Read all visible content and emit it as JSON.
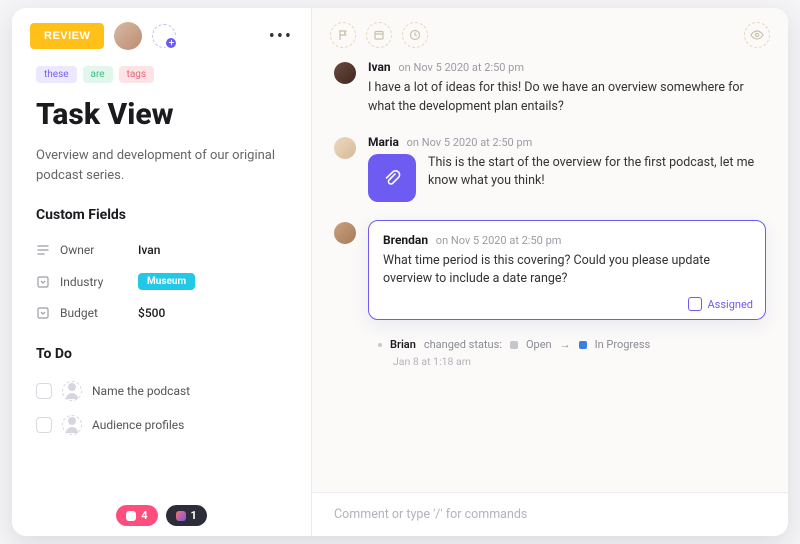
{
  "header": {
    "status_button": "REVIEW",
    "more_label": "•••"
  },
  "tags": [
    {
      "text": "these",
      "cls": "purple"
    },
    {
      "text": "are",
      "cls": "green"
    },
    {
      "text": "tags",
      "cls": "red"
    }
  ],
  "task": {
    "title": "Task View",
    "description": "Overview and development of our original podcast series."
  },
  "custom_fields": {
    "heading": "Custom Fields",
    "rows": [
      {
        "icon": "text-icon",
        "label": "Owner",
        "value": "Ivan",
        "type": "text"
      },
      {
        "icon": "dropdown-icon",
        "label": "Industry",
        "value": "Museum",
        "type": "pill",
        "pill_color": "#22c9e6"
      },
      {
        "icon": "dropdown-icon",
        "label": "Budget",
        "value": "$500",
        "type": "text"
      }
    ]
  },
  "todo": {
    "heading": "To Do",
    "items": [
      {
        "text": "Name the podcast"
      },
      {
        "text": "Audience profiles"
      }
    ]
  },
  "footer_chips": [
    {
      "cls": "pink",
      "count": "4"
    },
    {
      "cls": "dark",
      "count": "1"
    }
  ],
  "comments": [
    {
      "avatar": "brown",
      "name": "Ivan",
      "time": "on Nov 5 2020 at 2:50 pm",
      "text": "I have a lot of ideas for this! Do we have an overview somewhere for what the development plan entails?",
      "attachment": false,
      "assigned": false
    },
    {
      "avatar": "cream",
      "name": "Maria",
      "time": "on Nov 5 2020 at 2:50 pm",
      "text": "This is the start of the overview for the first podcast, let me know what you think!",
      "attachment": true,
      "assigned": false
    },
    {
      "avatar": "tan",
      "name": "Brendan",
      "time": "on Nov 5 2020 at 2:50 pm",
      "text": "What time period is this covering? Could you please update overview to include a date range?",
      "attachment": false,
      "assigned": true,
      "assigned_label": "Assigned"
    }
  ],
  "activity": {
    "actor": "Brian",
    "verb": "changed status:",
    "from": "Open",
    "to": "In Progress",
    "time": "Jan 8 at 1:18 am",
    "arrow": "→"
  },
  "compose": {
    "placeholder": "Comment or type '/' for commands"
  }
}
